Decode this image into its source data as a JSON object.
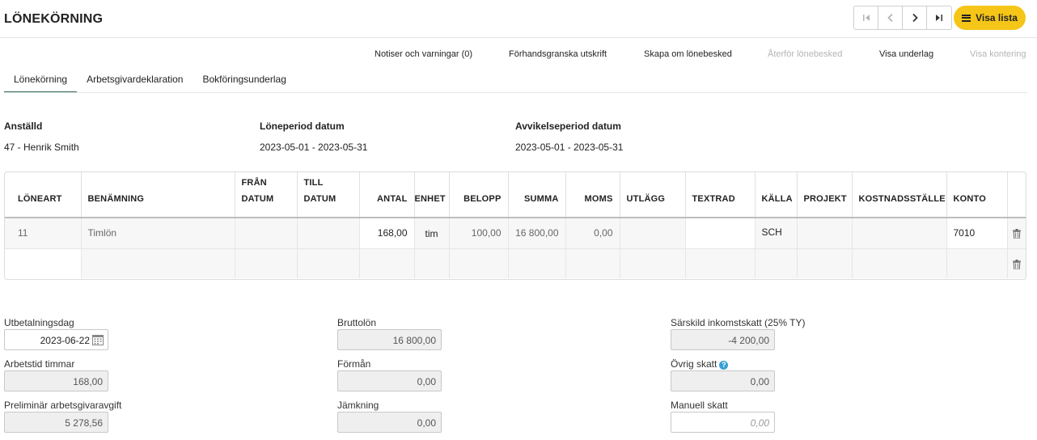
{
  "header": {
    "title": "LÖNEKÖRNING",
    "list_button": "Visa lista"
  },
  "actions": {
    "notices": "Notiser och varningar (0)",
    "preview": "Förhandsgranska utskrift",
    "recreate": "Skapa om lönebesked",
    "revert": "Återför lönebesked",
    "show_basis": "Visa underlag",
    "show_posting": "Visa kontering"
  },
  "tabs": [
    {
      "label": "Lönekörning",
      "active": true
    },
    {
      "label": "Arbetsgivardeklaration",
      "active": false
    },
    {
      "label": "Bokföringsunderlag",
      "active": false
    }
  ],
  "info": {
    "employee_label": "Anställd",
    "employee_value": "47 - Henrik Smith",
    "period_label": "Löneperiod datum",
    "period_value": "2023-05-01 - 2023-05-31",
    "deviation_label": "Avvikelseperiod datum",
    "deviation_value": "2023-05-01 - 2023-05-31"
  },
  "grid": {
    "columns": {
      "loneart": "LÖNEART",
      "benamning": "BENÄMNING",
      "fran": "FRÅN",
      "fran2": "DATUM",
      "till": "TILL",
      "till2": "DATUM",
      "antal": "ANTAL",
      "enhet": "ENHET",
      "belopp": "BELOPP",
      "summa": "SUMMA",
      "moms": "MOMS",
      "utlagg": "UTLÄGG",
      "textrad": "TEXTRAD",
      "kalla": "KÄLLA",
      "projekt": "PROJEKT",
      "kostnadsstalle": "KOSTNADSSTÄLLE",
      "konto": "KONTO"
    },
    "rows": [
      {
        "loneart": "11",
        "benamning": "Timlön",
        "fran": "",
        "till": "",
        "antal": "168,00",
        "enhet": "tim",
        "belopp": "100,00",
        "summa": "16 800,00",
        "moms": "0,00",
        "utlagg": "",
        "textrad": "",
        "kalla": "SCH",
        "projekt": "",
        "kostnadsstalle": "",
        "konto": "7010"
      }
    ]
  },
  "summary": {
    "payday_label": "Utbetalningsdag",
    "payday_value": "2023-06-22",
    "hours_label": "Arbetstid timmar",
    "hours_value": "168,00",
    "employer_fee_label": "Preliminär arbetsgivaravgift",
    "employer_fee_value": "5 278,56",
    "gross_label": "Bruttolön",
    "gross_value": "16 800,00",
    "benefit_label": "Förmån",
    "benefit_value": "0,00",
    "adjustment_label": "Jämkning",
    "adjustment_value": "0,00",
    "special_tax_label": "Särskild inkomstskatt (25% TY)",
    "special_tax_value": "-4 200,00",
    "other_tax_label": "Övrig skatt",
    "other_tax_value": "0,00",
    "manual_tax_label": "Manuell skatt",
    "manual_tax_placeholder": "0,00"
  },
  "colors": {
    "accent_yellow": "#f5c518",
    "tab_underline": "#2e6b55",
    "help_blue": "#3a9fd6"
  }
}
